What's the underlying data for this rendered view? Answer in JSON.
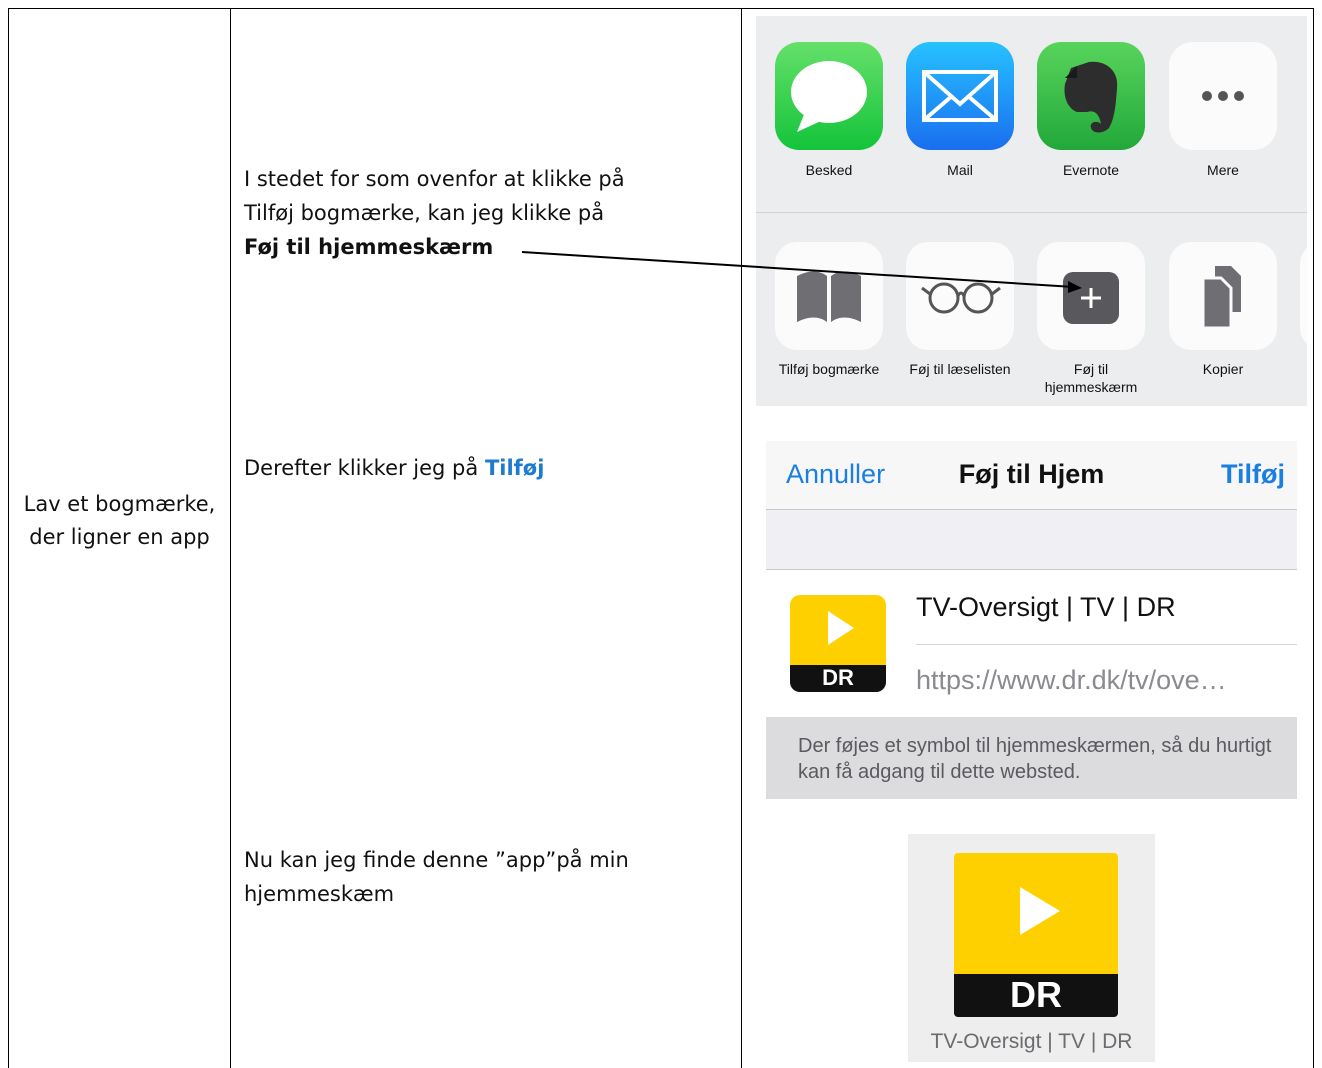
{
  "left_cell": {
    "label": "Lav et bogmærke, der ligner en app"
  },
  "steps": {
    "step1_line1": "I stedet for som ovenfor at klikke på",
    "step1_line2": "Tilføj bogmærke, kan jeg klikke på",
    "step1_bold": "Føj til hjemmeskærm",
    "step2_text": "Derefter klikker jeg på ",
    "step2_link": "Tilføj",
    "step3_line1": "Nu kan jeg finde denne ”app”på min",
    "step3_line2": "hjemmeskæm"
  },
  "share_sheet": {
    "apps": [
      {
        "label": "Besked",
        "icon": "messages-icon",
        "color": "#2fd04e"
      },
      {
        "label": "Mail",
        "icon": "mail-icon",
        "color": "#1e8ff5"
      },
      {
        "label": "Evernote",
        "icon": "evernote-icon",
        "color": "#36b84a"
      },
      {
        "label": "Mere",
        "icon": "more-icon",
        "color": "#ffffff"
      }
    ],
    "actions": [
      {
        "label": "Tilføj bogmærke",
        "icon": "bookmark-icon"
      },
      {
        "label": "Føj til læselisten",
        "icon": "reading-list-icon"
      },
      {
        "label_line1": "Føj til",
        "label_line2": "hjemmeskærm",
        "icon": "add-to-home-icon"
      },
      {
        "label": "Kopier",
        "icon": "copy-icon"
      }
    ]
  },
  "add_home": {
    "cancel": "Annuller",
    "title": "Føj til Hjem",
    "add": "Tilføj",
    "site_name": "TV-Oversigt | TV | DR",
    "url": "https://www.dr.dk/tv/ove…",
    "note": "Der føjes et symbol til hjemmeskærmen, så du hurtigt kan få adgang til dette websted."
  },
  "home_icon": {
    "logo_text": "DR",
    "caption": "TV-Oversigt | TV | DR"
  },
  "colors": {
    "ios_blue": "#1a7fe0",
    "dr_yellow": "#ffd000"
  }
}
